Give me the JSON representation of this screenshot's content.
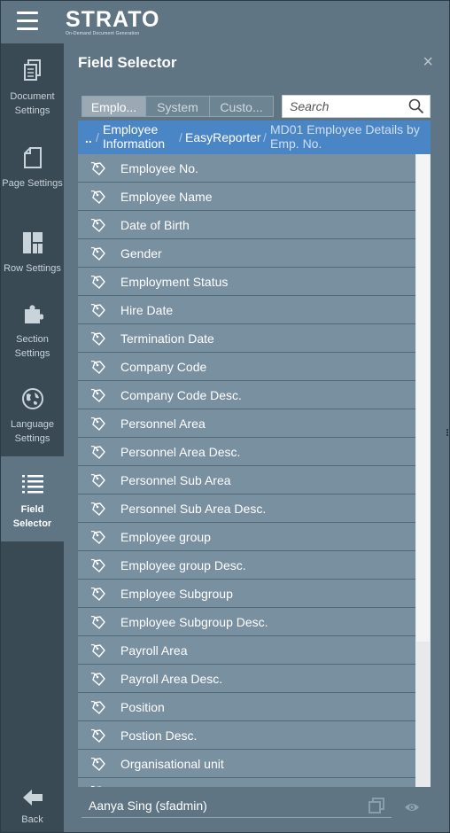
{
  "app": {
    "logo_title": "STRATO",
    "logo_subtitle": "On-Demand Document Generation"
  },
  "sidebar": {
    "items": [
      {
        "label": "Document Settings",
        "icon": "document-icon"
      },
      {
        "label": "Page Settings",
        "icon": "page-icon"
      },
      {
        "label": "Row Settings",
        "icon": "row-layout-icon"
      },
      {
        "label": "Section Settings",
        "icon": "puzzle-icon"
      },
      {
        "label": "Language Settings",
        "icon": "globe-icon"
      },
      {
        "label": "Field Selector",
        "icon": "list-icon",
        "active": true
      }
    ],
    "back_label": "Back"
  },
  "panel": {
    "title": "Field Selector",
    "close": "×",
    "tabs": [
      {
        "label": "Emplo...",
        "active": true
      },
      {
        "label": "System"
      },
      {
        "label": "Custo..."
      }
    ],
    "search_placeholder": "Search",
    "breadcrumb": {
      "root": "..",
      "items": [
        "Employee Information",
        "EasyReporter"
      ],
      "current": "MD01 Employee Details by Emp. No."
    },
    "fields": [
      "Employee No.",
      "Employee Name",
      "Date of Birth",
      "Gender",
      "Employment Status",
      "Hire Date",
      "Termination Date",
      "Company Code",
      "Company Code Desc.",
      "Personnel Area",
      "Personnel Area Desc.",
      "Personnel Sub Area",
      "Personnel Sub Area Desc.",
      "Employee group",
      "Employee group Desc.",
      "Employee Subgroup",
      "Employee Subgroup Desc.",
      "Payroll Area",
      "Payroll Area Desc.",
      "Position",
      "Postion Desc.",
      "Organisational unit",
      ""
    ],
    "user": "Aanya Sing (sfadmin)"
  },
  "colors": {
    "background": "#5f7584",
    "sidebar": "#3a4a55",
    "row": "#7890a0",
    "breadcrumb": "#4a86c5"
  }
}
